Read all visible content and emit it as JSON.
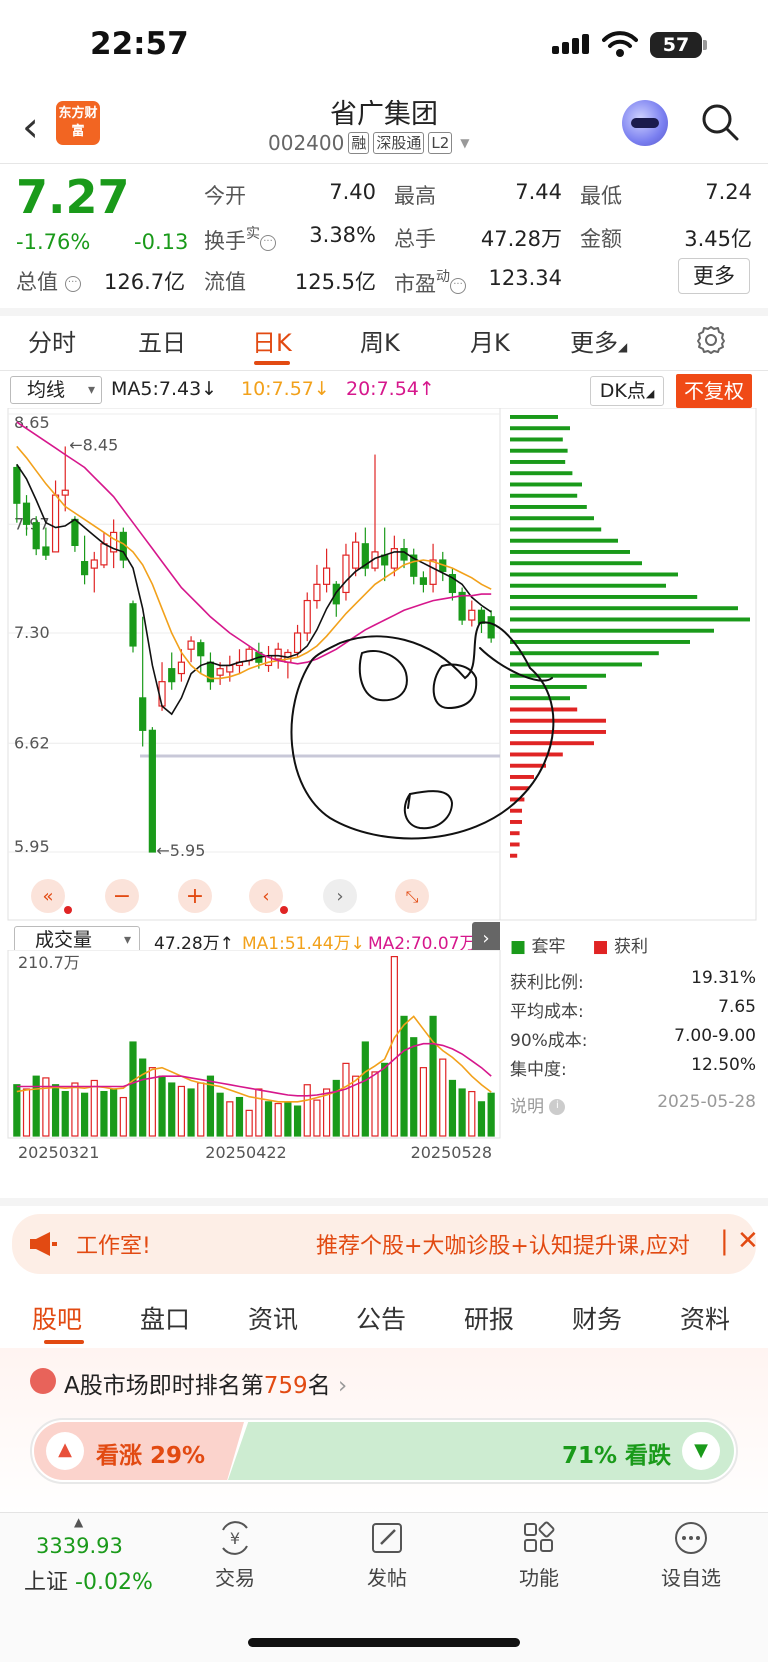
{
  "status_bar": {
    "time": "22:57",
    "battery": "57"
  },
  "header": {
    "logo_text": "东方财富",
    "title": "省广集团",
    "code": "002400",
    "tags": [
      "融",
      "深股通",
      "L2"
    ]
  },
  "quote": {
    "price": "7.27",
    "change_pct": "-1.76%",
    "change_abs": "-0.13",
    "rows": [
      [
        {
          "label": "今开",
          "value": "7.40",
          "color": "normal"
        },
        {
          "label": "最高",
          "value": "7.44",
          "color": "red"
        },
        {
          "label": "最低",
          "value": "7.24",
          "color": "green"
        }
      ],
      [
        {
          "label": "换手",
          "sup": "实",
          "value": "3.38%",
          "color": "normal"
        },
        {
          "label": "总手",
          "value": "47.28万",
          "color": "normal"
        },
        {
          "label": "金额",
          "value": "3.45亿",
          "color": "normal"
        }
      ],
      [
        {
          "label": "总值",
          "value": "126.7亿",
          "color": "normal"
        },
        {
          "label": "流值",
          "value": "125.5亿",
          "color": "normal"
        },
        {
          "label": "市盈",
          "sup": "动",
          "value": "123.34",
          "color": "normal"
        }
      ]
    ],
    "more_label": "更多"
  },
  "period_tabs": [
    "分时",
    "五日",
    "日K",
    "周K",
    "月K",
    "更多"
  ],
  "active_period": "日K",
  "ma_bar": {
    "select": "均线",
    "ma5": "MA5:7.43↓",
    "ma10": "10:7.57↓",
    "ma20": "20:7.54↑",
    "dk_label": "DK点",
    "adjust_label": "不复权"
  },
  "chart_data": [
    {
      "type": "candlestick",
      "title": "",
      "y_ticks": [
        "8.65",
        "7.97",
        "7.30",
        "6.62",
        "5.95"
      ],
      "ylim": [
        5.95,
        8.65
      ],
      "annotations": [
        "←8.45",
        "←5.95"
      ],
      "candles": [
        [
          8.32,
          8.1,
          8.34,
          7.98
        ],
        [
          8.1,
          7.97,
          8.15,
          7.9
        ],
        [
          7.98,
          7.82,
          8.02,
          7.78
        ],
        [
          7.83,
          7.78,
          7.95,
          7.75
        ],
        [
          7.8,
          8.15,
          8.24,
          7.8
        ],
        [
          8.15,
          8.18,
          8.45,
          8.05
        ],
        [
          8.0,
          7.84,
          8.02,
          7.8
        ],
        [
          7.74,
          7.66,
          7.9,
          7.6
        ],
        [
          7.7,
          7.75,
          7.8,
          7.55
        ],
        [
          7.72,
          7.85,
          7.92,
          7.7
        ],
        [
          7.8,
          7.92,
          8.0,
          7.7
        ],
        [
          7.92,
          7.75,
          7.95,
          7.7
        ],
        [
          7.48,
          7.22,
          7.5,
          7.18
        ],
        [
          6.9,
          6.7,
          7.4,
          6.6
        ],
        [
          6.7,
          5.95,
          6.72,
          5.95
        ],
        [
          6.85,
          7.0,
          7.12,
          6.82
        ],
        [
          7.08,
          7.0,
          7.18,
          6.95
        ],
        [
          7.05,
          7.12,
          7.2,
          7.0
        ],
        [
          7.2,
          7.25,
          7.28,
          7.12
        ],
        [
          7.24,
          7.16,
          7.26,
          7.05
        ],
        [
          7.12,
          7.0,
          7.18,
          6.95
        ],
        [
          7.04,
          7.08,
          7.12,
          6.98
        ],
        [
          7.06,
          7.1,
          7.16,
          7.0
        ],
        [
          7.1,
          7.12,
          7.2,
          7.05
        ],
        [
          7.13,
          7.2,
          7.22,
          7.1
        ],
        [
          7.18,
          7.12,
          7.24,
          7.08
        ],
        [
          7.1,
          7.16,
          7.22,
          7.06
        ],
        [
          7.14,
          7.2,
          7.24,
          7.08
        ],
        [
          7.12,
          7.18,
          7.2,
          7.02
        ],
        [
          7.18,
          7.3,
          7.35,
          7.15
        ],
        [
          7.3,
          7.5,
          7.55,
          7.25
        ],
        [
          7.5,
          7.6,
          7.72,
          7.45
        ],
        [
          7.6,
          7.7,
          7.82,
          7.55
        ],
        [
          7.6,
          7.48,
          7.62,
          7.4
        ],
        [
          7.55,
          7.78,
          7.85,
          7.5
        ],
        [
          7.7,
          7.86,
          7.92,
          7.65
        ],
        [
          7.85,
          7.7,
          7.95,
          7.65
        ],
        [
          7.7,
          7.8,
          8.4,
          7.68
        ],
        [
          7.78,
          7.72,
          7.95,
          7.62
        ],
        [
          7.7,
          7.82,
          7.9,
          7.65
        ],
        [
          7.82,
          7.75,
          7.88,
          7.7
        ],
        [
          7.78,
          7.65,
          7.82,
          7.6
        ],
        [
          7.64,
          7.6,
          7.68,
          7.55
        ],
        [
          7.6,
          7.75,
          7.85,
          7.55
        ],
        [
          7.75,
          7.68,
          7.8,
          7.62
        ],
        [
          7.66,
          7.55,
          7.7,
          7.5
        ],
        [
          7.55,
          7.38,
          7.58,
          7.35
        ],
        [
          7.38,
          7.44,
          7.5,
          7.34
        ],
        [
          7.44,
          7.36,
          7.46,
          7.3
        ],
        [
          7.4,
          7.27,
          7.44,
          7.24
        ]
      ],
      "ma5": [
        8.34,
        8.25,
        8.12,
        7.98,
        7.95,
        7.96,
        8.0,
        7.95,
        7.9,
        7.85,
        7.82,
        7.8,
        7.7,
        7.45,
        7.1,
        6.85,
        6.8,
        6.9,
        7.05,
        7.1,
        7.12,
        7.1,
        7.1,
        7.12,
        7.13,
        7.15,
        7.16,
        7.16,
        7.15,
        7.17,
        7.22,
        7.32,
        7.45,
        7.55,
        7.62,
        7.68,
        7.72,
        7.76,
        7.78,
        7.8,
        7.8,
        7.76,
        7.73,
        7.7,
        7.67,
        7.64,
        7.6,
        7.52,
        7.47,
        7.43
      ],
      "ma10": [
        8.45,
        8.38,
        8.3,
        8.22,
        8.15,
        8.08,
        8.04,
        8.0,
        7.96,
        7.92,
        7.88,
        7.85,
        7.8,
        7.72,
        7.6,
        7.45,
        7.3,
        7.18,
        7.1,
        7.05,
        7.02,
        7.02,
        7.03,
        7.05,
        7.08,
        7.1,
        7.12,
        7.13,
        7.14,
        7.15,
        7.18,
        7.22,
        7.28,
        7.35,
        7.42,
        7.48,
        7.54,
        7.6,
        7.64,
        7.68,
        7.72,
        7.74,
        7.75,
        7.74,
        7.72,
        7.7,
        7.67,
        7.64,
        7.6,
        7.57
      ],
      "ma20": [
        8.6,
        8.56,
        8.52,
        8.48,
        8.44,
        8.4,
        8.36,
        8.32,
        8.26,
        8.2,
        8.14,
        8.06,
        7.98,
        7.9,
        7.82,
        7.74,
        7.66,
        7.58,
        7.52,
        7.46,
        7.4,
        7.35,
        7.3,
        7.26,
        7.22,
        7.18,
        7.15,
        7.13,
        7.12,
        7.11,
        7.12,
        7.14,
        7.17,
        7.2,
        7.24,
        7.28,
        7.32,
        7.35,
        7.38,
        7.41,
        7.44,
        7.46,
        7.48,
        7.5,
        7.51,
        7.52,
        7.53,
        7.53,
        7.54,
        7.54
      ]
    },
    {
      "type": "bar",
      "title": "",
      "y_top_label": "210.7万",
      "ylim": [
        0,
        210.7
      ],
      "categories": [
        "20250321",
        "20250422",
        "20250528"
      ],
      "values": [
        60,
        55,
        70,
        68,
        60,
        52,
        62,
        50,
        65,
        52,
        55,
        45,
        110,
        90,
        80,
        70,
        62,
        58,
        55,
        62,
        70,
        50,
        40,
        45,
        30,
        55,
        40,
        38,
        40,
        35,
        60,
        42,
        55,
        65,
        85,
        70,
        110,
        75,
        85,
        210,
        140,
        115,
        80,
        140,
        90,
        65,
        55,
        52,
        40,
        50
      ],
      "up": [
        false,
        true,
        false,
        true,
        false,
        false,
        true,
        false,
        true,
        false,
        false,
        true,
        false,
        false,
        true,
        false,
        false,
        true,
        false,
        true,
        false,
        false,
        true,
        false,
        true,
        true,
        false,
        true,
        false,
        false,
        true,
        true,
        true,
        false,
        true,
        true,
        false,
        true,
        false,
        true,
        false,
        false,
        true,
        false,
        true,
        false,
        false,
        true,
        false,
        false
      ],
      "ma1": [
        52,
        54,
        55,
        56,
        57,
        56,
        57,
        56,
        58,
        57,
        55,
        56,
        65,
        72,
        78,
        80,
        75,
        70,
        65,
        62,
        60,
        58,
        54,
        50,
        46,
        44,
        42,
        40,
        40,
        40,
        42,
        45,
        48,
        52,
        58,
        65,
        75,
        82,
        90,
        115,
        130,
        140,
        125,
        110,
        100,
        92,
        82,
        70,
        60,
        51.44
      ],
      "ma2": [
        58,
        58,
        58,
        58,
        58,
        58,
        58,
        58,
        58,
        58,
        58,
        58,
        62,
        66,
        68,
        70,
        70,
        70,
        68,
        66,
        64,
        62,
        60,
        58,
        56,
        54,
        52,
        50,
        48,
        47,
        47,
        48,
        50,
        52,
        55,
        60,
        65,
        72,
        80,
        90,
        100,
        105,
        108,
        108,
        106,
        102,
        96,
        88,
        80,
        70.07
      ]
    }
  ],
  "chips_profile": [
    {
      "v": 0.2,
      "profit": false
    },
    {
      "v": 0.25,
      "profit": false
    },
    {
      "v": 0.22,
      "profit": false
    },
    {
      "v": 0.24,
      "profit": false
    },
    {
      "v": 0.23,
      "profit": false
    },
    {
      "v": 0.26,
      "profit": false
    },
    {
      "v": 0.3,
      "profit": false
    },
    {
      "v": 0.28,
      "profit": false
    },
    {
      "v": 0.32,
      "profit": false
    },
    {
      "v": 0.35,
      "profit": false
    },
    {
      "v": 0.38,
      "profit": false
    },
    {
      "v": 0.45,
      "profit": false
    },
    {
      "v": 0.5,
      "profit": false
    },
    {
      "v": 0.55,
      "profit": false
    },
    {
      "v": 0.7,
      "profit": false
    },
    {
      "v": 0.65,
      "profit": false
    },
    {
      "v": 0.78,
      "profit": false
    },
    {
      "v": 0.95,
      "profit": false
    },
    {
      "v": 1.0,
      "profit": false
    },
    {
      "v": 0.85,
      "profit": false
    },
    {
      "v": 0.75,
      "profit": false
    },
    {
      "v": 0.62,
      "profit": false
    },
    {
      "v": 0.55,
      "profit": false
    },
    {
      "v": 0.4,
      "profit": false
    },
    {
      "v": 0.32,
      "profit": false
    },
    {
      "v": 0.25,
      "profit": false
    },
    {
      "v": 0.28,
      "profit": true
    },
    {
      "v": 0.4,
      "profit": true
    },
    {
      "v": 0.4,
      "profit": true
    },
    {
      "v": 0.35,
      "profit": true
    },
    {
      "v": 0.22,
      "profit": true
    },
    {
      "v": 0.15,
      "profit": true
    },
    {
      "v": 0.1,
      "profit": true
    },
    {
      "v": 0.08,
      "profit": true
    },
    {
      "v": 0.06,
      "profit": true
    },
    {
      "v": 0.05,
      "profit": true
    },
    {
      "v": 0.05,
      "profit": true
    },
    {
      "v": 0.04,
      "profit": true
    },
    {
      "v": 0.04,
      "profit": true
    },
    {
      "v": 0.03,
      "profit": true
    }
  ],
  "volume_bar": {
    "select": "成交量",
    "today": "47.28万↑",
    "ma1": "MA1:51.44万↓",
    "ma2": "MA2:70.07万"
  },
  "chips": {
    "legend_solid": "套牢",
    "legend_profit": "获利",
    "rows": [
      {
        "label": "获利比例:",
        "value": "19.31%"
      },
      {
        "label": "平均成本:",
        "value": "7.65"
      },
      {
        "label": "90%成本:",
        "value": "7.00-9.00"
      },
      {
        "label": "集中度:",
        "value": "12.50%"
      },
      {
        "label": "说明",
        "value": "2025-05-28"
      }
    ]
  },
  "banner": {
    "left": "工作室!",
    "right": "推荐个股+大咖诊股+认知提升课,应对"
  },
  "content_tabs": [
    "股吧",
    "盘口",
    "资讯",
    "公告",
    "研报",
    "财务",
    "资料"
  ],
  "rank": {
    "prefix": "A股市场即时排名第",
    "number": "759",
    "suffix": "名"
  },
  "vote": {
    "up": "看涨 29%",
    "down": "71% 看跌",
    "up_fraction": 0.29
  },
  "bottom_nav": {
    "index_value": "3339.93",
    "index_name": "上证",
    "index_change": "-0.02%",
    "items": [
      "交易",
      "发帖",
      "功能",
      "设自选"
    ]
  },
  "colors": {
    "accent": "#e24a12",
    "up": "#e02424",
    "down": "#1a9a1a",
    "ma10": "#f2a11b",
    "ma20": "#d6178c"
  }
}
